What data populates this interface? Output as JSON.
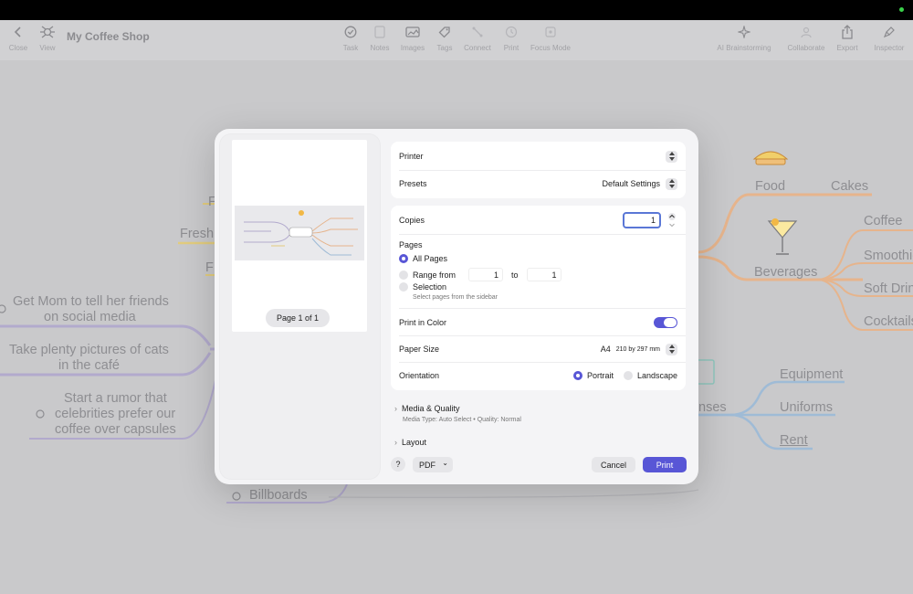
{
  "toolbar": {
    "close_label": "Close",
    "view_label": "View",
    "doc_title": "My Coffee Shop",
    "center_items": [
      {
        "label": "Task",
        "icon": "check-circle-icon"
      },
      {
        "label": "Notes",
        "icon": "note-icon"
      },
      {
        "label": "Images",
        "icon": "images-icon"
      },
      {
        "label": "Tags",
        "icon": "tag-icon"
      },
      {
        "label": "Connect",
        "icon": "connect-icon"
      },
      {
        "label": "Print",
        "icon": "print-icon"
      },
      {
        "label": "Focus Mode",
        "icon": "focus-icon"
      }
    ],
    "right_items": [
      {
        "label": "AI Brainstorming",
        "icon": "sparkle-icon"
      },
      {
        "label": "Collaborate",
        "icon": "collaborate-icon"
      },
      {
        "label": "Export",
        "icon": "share-icon"
      },
      {
        "label": "Inspector",
        "icon": "brush-icon"
      }
    ]
  },
  "mindmap": {
    "left_nodes": [
      "Get Mom to tell her friends",
      "on social media",
      "Take plenty pictures of cats",
      "in the café",
      "Start a rumor that",
      "celebrities prefer our",
      "coffee over capsules"
    ],
    "left_partial": [
      "Fresh",
      "F",
      "F"
    ],
    "bottom_node": "Billboards",
    "right_nodes": {
      "food": "Food",
      "cakes": "Cakes",
      "beverages": "Beverages",
      "coffee": "Coffee",
      "smoothies": "Smoothie",
      "soft_drinks": "Soft Drin",
      "cocktails": "Cocktails",
      "equipment": "Equipment",
      "uniforms": "Uniforms",
      "rent": "Rent",
      "expenses_partial": "nses"
    }
  },
  "colors": {
    "accent": "#5856d6",
    "purple_branch": "#b2aacd",
    "orange_branch": "#e6b48c",
    "blue_branch": "#9fbbd6",
    "yellow_branch": "#e2cc7e"
  },
  "dialog": {
    "preview": {
      "page_indicator": "Page 1 of 1"
    },
    "printer_label": "Printer",
    "presets_label": "Presets",
    "presets_value": "Default Settings",
    "copies_label": "Copies",
    "copies_value": "1",
    "pages_label": "Pages",
    "all_pages": "All Pages",
    "range_from": "Range from",
    "range_start": "1",
    "range_to": "to",
    "range_end": "1",
    "selection": "Selection",
    "selection_hint": "Select pages from the sidebar",
    "print_in_color": "Print in Color",
    "paper_size_label": "Paper Size",
    "paper_size_value": "A4",
    "paper_size_dims": "210 by 297 mm",
    "orientation_label": "Orientation",
    "portrait": "Portrait",
    "landscape": "Landscape",
    "media_quality": "Media & Quality",
    "media_quality_sub": "Media Type: Auto Select • Quality: Normal",
    "layout": "Layout",
    "help": "?",
    "pdf": "PDF",
    "cancel": "Cancel",
    "print": "Print"
  }
}
